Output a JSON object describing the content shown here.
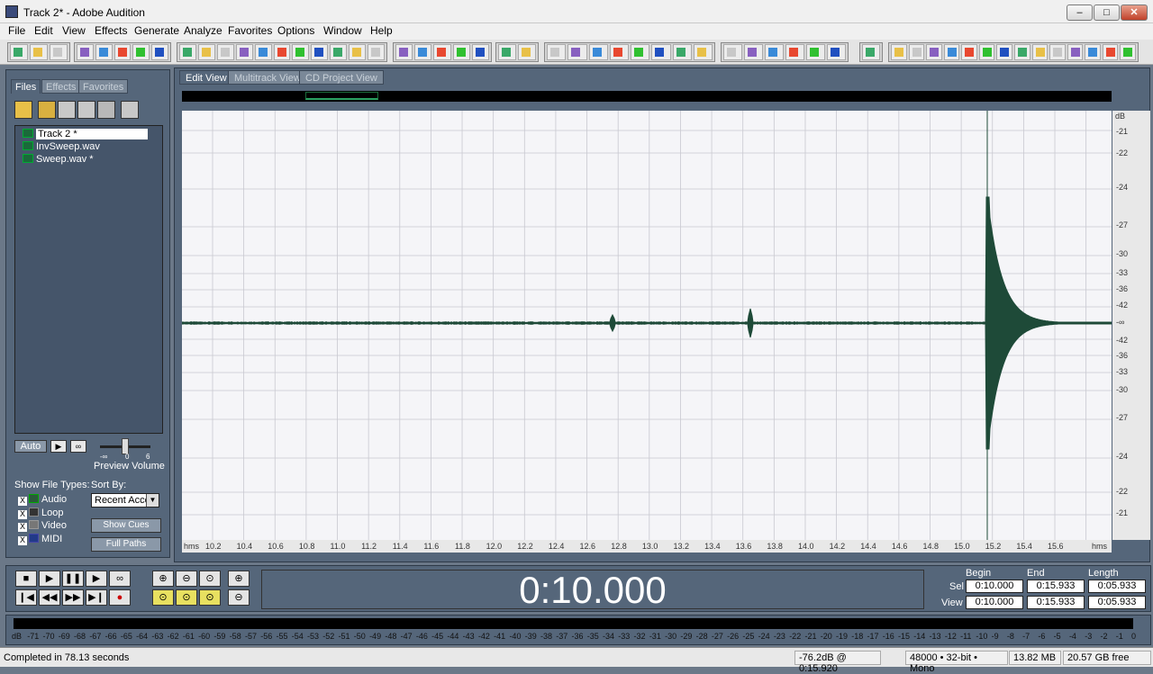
{
  "window": {
    "title": "Track 2* - Adobe Audition",
    "min": "–",
    "max": "□",
    "close": "✕"
  },
  "menu": [
    "File",
    "Edit",
    "View",
    "Effects",
    "Generate",
    "Analyze",
    "Favorites",
    "Options",
    "Window",
    "Help"
  ],
  "colors": {
    "panel": "#55667a",
    "waveform": "#1e4a38",
    "grid": "#c8c8d0"
  },
  "files_panel": {
    "tabs": [
      "Files",
      "Effects",
      "Favorites"
    ],
    "files": [
      "Track 2 *",
      "InvSweep.wav",
      "Sweep.wav *"
    ],
    "auto_label": "Auto",
    "play_icon": "▶",
    "loop_icon": "∞",
    "volume_ticks": {
      "left": "-∞",
      "mid": "0",
      "right": "6"
    },
    "preview_volume": "Preview Volume",
    "show_file_types": "Show File Types:",
    "sort_by": "Sort By:",
    "types": [
      {
        "label": "Audio",
        "check": "X"
      },
      {
        "label": "Loop",
        "check": "X"
      },
      {
        "label": "Video",
        "check": "X"
      },
      {
        "label": "MIDI",
        "check": "X"
      }
    ],
    "sort_value": "Recent Acce",
    "show_cues": "Show Cues",
    "full_paths": "Full Paths"
  },
  "view_tabs": [
    "Edit View",
    "Multitrack View",
    "CD Project View"
  ],
  "db_ruler": {
    "unit": "dB",
    "top_ticks": [
      "-21",
      "-22",
      "-24",
      "-27",
      "-30",
      "-33",
      "-36",
      "-42"
    ],
    "center": "-∞",
    "bottom_ticks": [
      "-42",
      "-36",
      "-33",
      "-30",
      "-27",
      "-24",
      "-22",
      "-21"
    ]
  },
  "time_ruler": {
    "unit": "hms",
    "ticks": [
      "10.2",
      "10.4",
      "10.6",
      "10.8",
      "11.0",
      "11.2",
      "11.4",
      "11.6",
      "11.8",
      "12.0",
      "12.2",
      "12.4",
      "12.6",
      "12.8",
      "13.0",
      "13.2",
      "13.4",
      "13.6",
      "13.8",
      "14.0",
      "14.2",
      "14.4",
      "14.6",
      "14.8",
      "15.0",
      "15.2",
      "15.4",
      "15.6"
    ]
  },
  "transport": {
    "buttons_row1": [
      "■",
      "▶",
      "❚❚",
      "▶",
      "∞"
    ],
    "buttons_row2": [
      "❙◀",
      "◀◀",
      "▶▶",
      "▶❙",
      "●"
    ],
    "time": "0:10.000"
  },
  "selection": {
    "headers": [
      "Begin",
      "End",
      "Length"
    ],
    "sel_label": "Sel",
    "view_label": "View",
    "sel": [
      "0:10.000",
      "0:15.933",
      "0:05.933"
    ],
    "view": [
      "0:10.000",
      "0:15.933",
      "0:05.933"
    ]
  },
  "meter": {
    "labels": [
      "dB",
      "-71",
      "-70",
      "-69",
      "-68",
      "-67",
      "-66",
      "-65",
      "-64",
      "-63",
      "-62",
      "-61",
      "-60",
      "-59",
      "-58",
      "-57",
      "-56",
      "-55",
      "-54",
      "-53",
      "-52",
      "-51",
      "-50",
      "-49",
      "-48",
      "-47",
      "-46",
      "-45",
      "-44",
      "-43",
      "-42",
      "-41",
      "-40",
      "-39",
      "-38",
      "-37",
      "-36",
      "-35",
      "-34",
      "-33",
      "-32",
      "-31",
      "-30",
      "-29",
      "-28",
      "-27",
      "-26",
      "-25",
      "-24",
      "-23",
      "-22",
      "-21",
      "-20",
      "-19",
      "-18",
      "-17",
      "-16",
      "-15",
      "-14",
      "-13",
      "-12",
      "-11",
      "-10",
      "-9",
      "-8",
      "-7",
      "-6",
      "-5",
      "-4",
      "-3",
      "-2",
      "-1",
      "0"
    ]
  },
  "status": {
    "message": "Completed in 78.13 seconds",
    "level": "-76.2dB @  0:15.920",
    "format": "48000 • 32-bit • Mono",
    "size": "13.82 MB",
    "free": "20.57 GB free"
  }
}
